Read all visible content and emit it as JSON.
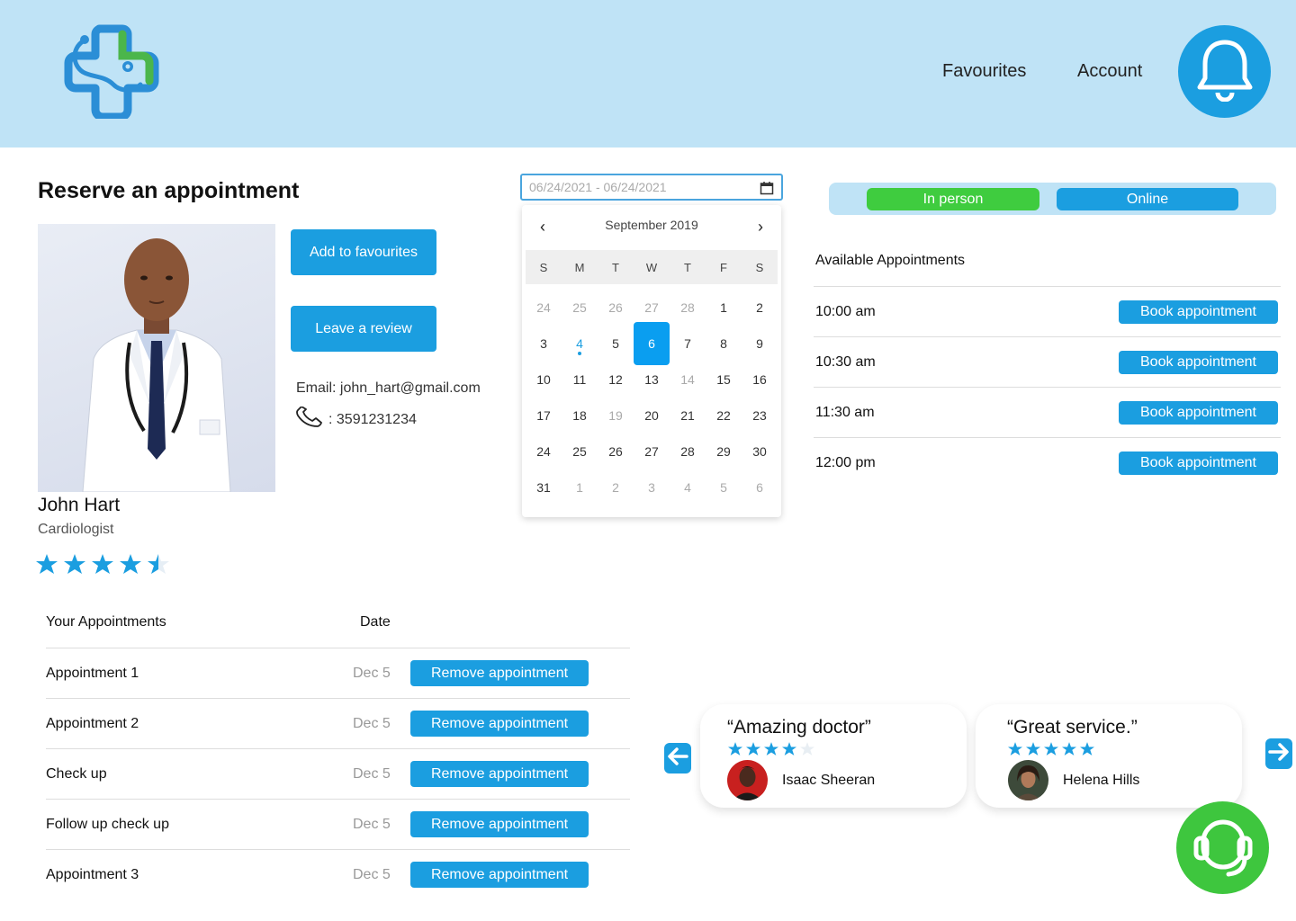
{
  "nav": {
    "favourites": "Favourites",
    "account": "Account"
  },
  "page_title": "Reserve an appointment",
  "doctor": {
    "name": "John Hart",
    "role": "Cardiologist",
    "rating": 4.5,
    "email": "Email: john_hart@gmail.com",
    "phone": ": 3591231234"
  },
  "actions": {
    "favourites": "Add to favourites",
    "review": "Leave a review"
  },
  "date_range": {
    "placeholder": "06/24/2021 - 06/24/2021"
  },
  "calendar": {
    "month_label": "September  2019",
    "weekdays": [
      "S",
      "M",
      "T",
      "W",
      "T",
      "F",
      "S"
    ],
    "days": [
      {
        "d": "24",
        "muted": true
      },
      {
        "d": "25",
        "muted": true
      },
      {
        "d": "26",
        "muted": true
      },
      {
        "d": "27",
        "muted": true
      },
      {
        "d": "28",
        "muted": true
      },
      {
        "d": "1"
      },
      {
        "d": "2"
      },
      {
        "d": "3"
      },
      {
        "d": "4",
        "dot": true
      },
      {
        "d": "5"
      },
      {
        "d": "6",
        "selected": true
      },
      {
        "d": "7"
      },
      {
        "d": "8"
      },
      {
        "d": "9"
      },
      {
        "d": "10"
      },
      {
        "d": "11"
      },
      {
        "d": "12"
      },
      {
        "d": "13"
      },
      {
        "d": "14",
        "muted": true
      },
      {
        "d": "15"
      },
      {
        "d": "16"
      },
      {
        "d": "17"
      },
      {
        "d": "18"
      },
      {
        "d": "19",
        "muted": true
      },
      {
        "d": "20"
      },
      {
        "d": "21"
      },
      {
        "d": "22"
      },
      {
        "d": "23"
      },
      {
        "d": "24"
      },
      {
        "d": "25"
      },
      {
        "d": "26"
      },
      {
        "d": "27"
      },
      {
        "d": "28"
      },
      {
        "d": "29"
      },
      {
        "d": "30"
      },
      {
        "d": "31"
      },
      {
        "d": "1",
        "muted": true
      },
      {
        "d": "2",
        "muted": true
      },
      {
        "d": "3",
        "muted": true
      },
      {
        "d": "4",
        "muted": true
      },
      {
        "d": "5",
        "muted": true
      },
      {
        "d": "6",
        "muted": true
      }
    ]
  },
  "mode": {
    "in_person": "In person",
    "online": "Online",
    "in_person_color": "#3fcc3f",
    "online_color": "#1b9ee0"
  },
  "available": {
    "title": "Available Appointments",
    "book_label": "Book appointment",
    "slots": [
      "10:00 am",
      "10:30 am",
      "11:30 am",
      "12:00 pm"
    ]
  },
  "your_appointments": {
    "col_name": "Your Appointments",
    "col_date": "Date",
    "remove_label": "Remove appointment",
    "rows": [
      {
        "name": "Appointment 1",
        "date": "Dec 5"
      },
      {
        "name": "Appointment 2",
        "date": "Dec 5"
      },
      {
        "name": "Check up",
        "date": "Dec 5"
      },
      {
        "name": "Follow up check up",
        "date": "Dec 5"
      },
      {
        "name": "Appointment 3",
        "date": "Dec 5"
      }
    ]
  },
  "reviews": [
    {
      "quote": "“Amazing doctor”",
      "author": "Isaac Sheeran",
      "stars": 4
    },
    {
      "quote": "“Great service.”",
      "author": "Helena Hills",
      "stars": 5
    }
  ],
  "colors": {
    "accent": "#1b9ee0",
    "header_bg": "#bfe3f6",
    "support": "#3ec63e"
  }
}
